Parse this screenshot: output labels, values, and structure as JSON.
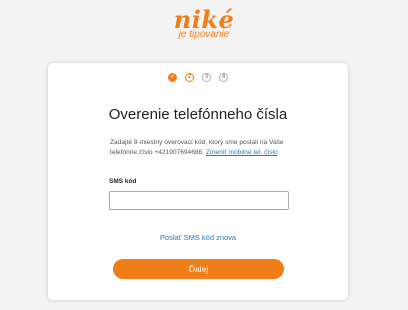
{
  "logo": {
    "main": "niké",
    "sub": "je tipovanie"
  },
  "steps": [
    {
      "mark": "✓",
      "state": "done"
    },
    {
      "mark": "2",
      "state": "active"
    },
    {
      "mark": "3",
      "state": "todo"
    },
    {
      "mark": "4",
      "state": "todo"
    }
  ],
  "title": "Overenie telefónneho čísla",
  "description": {
    "text": "Zadajte 8-miestny overovací kód, ktorý sme poslali na Vaše telefónne číslo +421907694686.",
    "link": "Zmeniť mobilné tel. číslo"
  },
  "sms_field": {
    "label": "SMS kód",
    "value": "",
    "placeholder": ""
  },
  "resend_label": "Poslať SMS kód znova",
  "submit_label": "Ďalej",
  "colors": {
    "accent": "#f07d17",
    "link": "#2a7ab8",
    "background": "#f3f3f3"
  }
}
